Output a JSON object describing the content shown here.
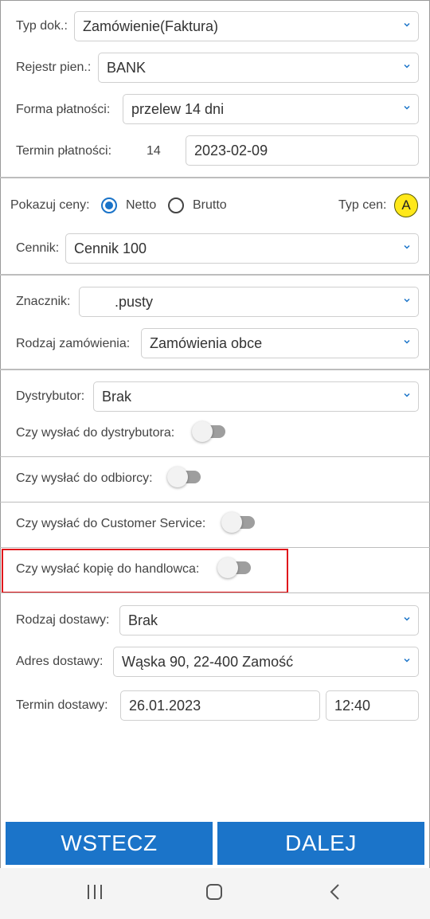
{
  "header_form": {
    "typ_dok": {
      "label": "Typ dok.:",
      "value": "Zamówienie(Faktura)"
    },
    "rejestr": {
      "label": "Rejestr pien.:",
      "value": "BANK"
    },
    "forma": {
      "label": "Forma płatności:",
      "value": "przelew 14 dni"
    },
    "termin": {
      "label": "Termin płatności:",
      "days": "14",
      "date": "2023-02-09"
    }
  },
  "prices": {
    "label": "Pokazuj ceny:",
    "netto": "Netto",
    "brutto": "Brutto",
    "selected": "Netto",
    "typ_cen_label": "Typ cen:",
    "typ_cen_value": "A",
    "cennik": {
      "label": "Cennik:",
      "value": "Cennik 100"
    }
  },
  "order": {
    "znacznik": {
      "label": "Znacznik:",
      "value": ".pusty"
    },
    "rodzaj": {
      "label": "Rodzaj zamówienia:",
      "value": "Zamówienia obce"
    }
  },
  "distribution": {
    "dystrybutor": {
      "label": "Dystrybutor:",
      "value": "Brak"
    },
    "send_distributor": {
      "label": "Czy wysłać do dystrybutora:",
      "on": false
    },
    "send_recipient": {
      "label": "Czy wysłać do odbiorcy:",
      "on": false
    },
    "send_cs": {
      "label": "Czy wysłać do Customer Service:",
      "on": false
    },
    "send_copy": {
      "label": "Czy wysłać kopię do handlowca:",
      "on": false
    }
  },
  "delivery": {
    "rodzaj": {
      "label": "Rodzaj dostawy:",
      "value": "Brak"
    },
    "adres": {
      "label": "Adres dostawy:",
      "value": "Wąska 90, 22-400 Zamość"
    },
    "termin": {
      "label": "Termin dostawy:",
      "date": "26.01.2023",
      "time": "12:40"
    }
  },
  "buttons": {
    "back": "WSTECZ",
    "next": "DALEJ"
  },
  "colors": {
    "accent": "#1b74c9",
    "highlight": "#e0161b",
    "badge": "#ffe81a"
  },
  "nav_icons": [
    "recent-apps-icon",
    "home-icon",
    "back-icon"
  ]
}
